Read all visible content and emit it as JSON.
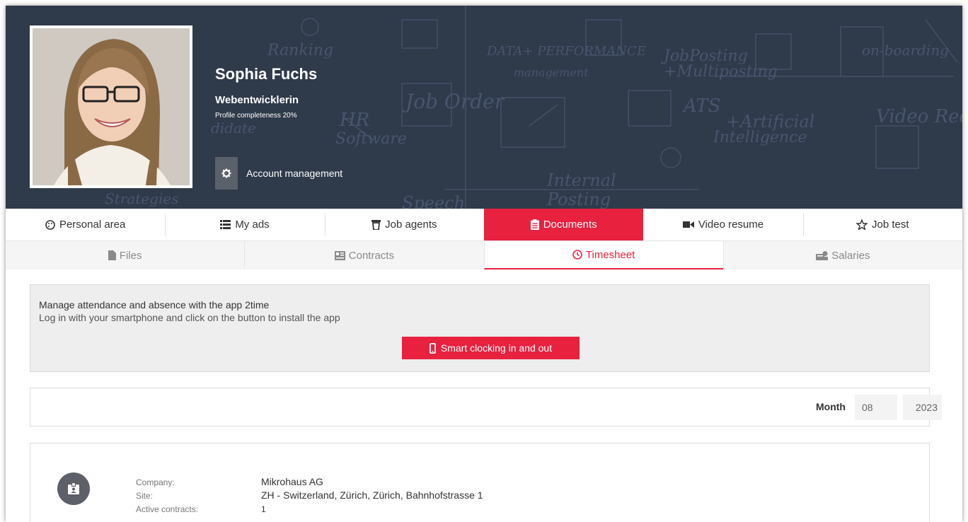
{
  "profile": {
    "name": "Sophia Fuchs",
    "job_title": "Webentwicklerin",
    "completeness": "Profile completeness 20%",
    "account_management": "Account management"
  },
  "hero_words": [
    "Ranking",
    "Job Order",
    "DATA+ PERFORMANCE",
    "management",
    "JobPosting",
    "+Multiposting",
    "on-boarding",
    "Video Recruit",
    "ATS",
    "+Artificial",
    "Intelligence",
    "HR",
    "Software",
    "Internal",
    "Posting",
    "Speech",
    "Strategies",
    "didate"
  ],
  "tabs": [
    {
      "label": "Personal area",
      "icon": "palette-icon"
    },
    {
      "label": "My ads",
      "icon": "list-icon"
    },
    {
      "label": "Job agents",
      "icon": "trash-icon"
    },
    {
      "label": "Documents",
      "icon": "clipboard-icon",
      "active": true
    },
    {
      "label": "Video resume",
      "icon": "video-camera-icon"
    },
    {
      "label": "Job test",
      "icon": "star-outline-icon"
    }
  ],
  "subtabs": [
    {
      "label": "Files",
      "icon": "file-icon"
    },
    {
      "label": "Contracts",
      "icon": "contracts-icon"
    },
    {
      "label": "Timesheet",
      "icon": "clock-icon",
      "active": true
    },
    {
      "label": "Salaries",
      "icon": "salaries-icon"
    }
  ],
  "info": {
    "title": "Manage attendance and absence with the app 2time",
    "subtitle": "Log in with your smartphone and click on the button to install the app",
    "button": "Smart clocking in and out"
  },
  "filter": {
    "month_label": "Month",
    "month_value": "08",
    "year_value": "2023"
  },
  "company": {
    "company_label": "Company:",
    "company_value": "Mikrohaus AG",
    "site_label": "Site:",
    "site_value": "ZH - Switzerland, Zürich, Zürich, Bahnhofstrasse 1",
    "contracts_label": "Active contracts:",
    "contracts_value": "1"
  },
  "colors": {
    "accent": "#e8213f",
    "hero_bg": "#2f3a4b",
    "panel_bg": "#eeeeee"
  }
}
